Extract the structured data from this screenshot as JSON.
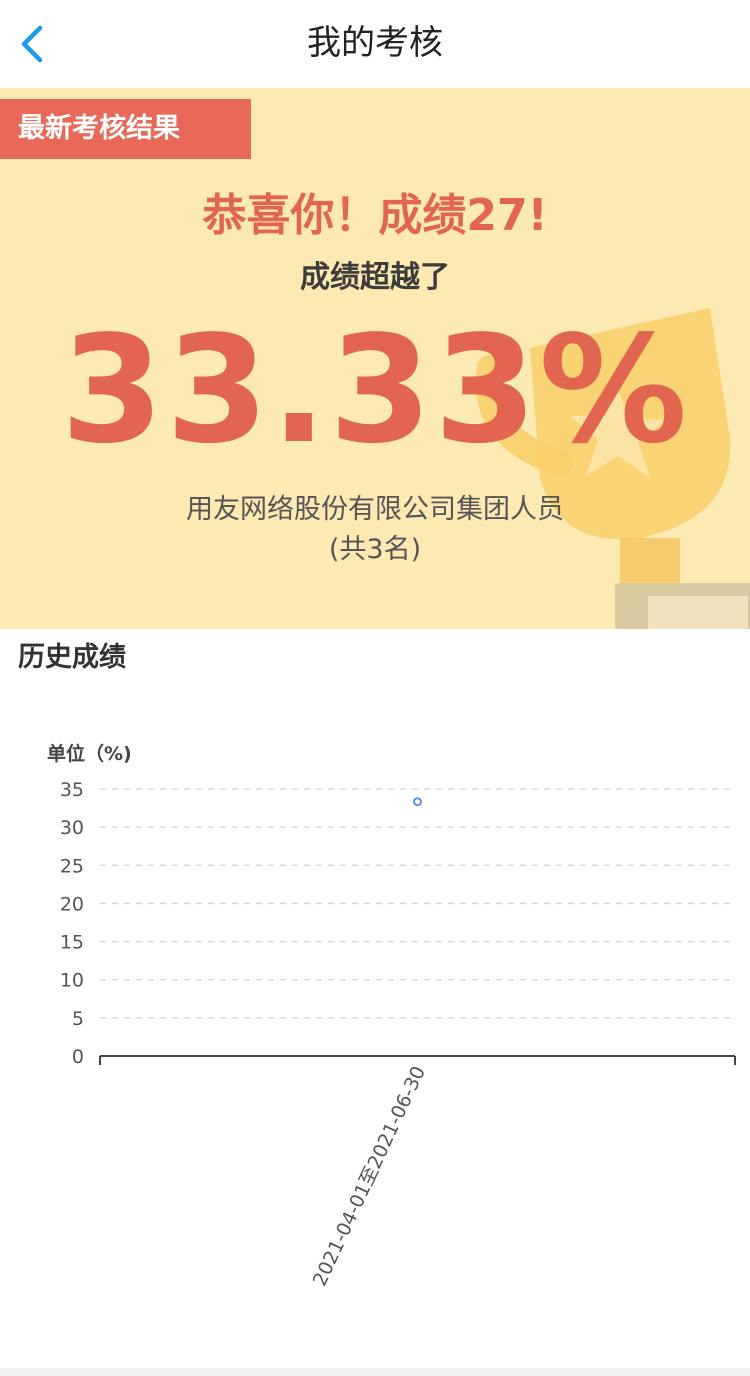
{
  "header": {
    "title": "我的考核",
    "back_icon": "chevron-left-icon",
    "accent_color": "#1e9bf0"
  },
  "result": {
    "tag": "最新考核结果",
    "congrats": "恭喜你！成绩27!",
    "beyond_label": "成绩超越了",
    "percent": "33.33%",
    "org_name": "用友网络股份有限公司集团人员",
    "member_count": "(共3名)",
    "background_color": "#fde9b2",
    "accent_color": "#e2654f",
    "decoration_icon": "trophy-icon"
  },
  "history": {
    "title": "历史成绩"
  },
  "chart_data": {
    "type": "scatter",
    "ylabel": "单位（%)",
    "ylim": [
      0,
      35
    ],
    "yticks": [
      "0",
      "5",
      "10",
      "15",
      "20",
      "25",
      "30",
      "35"
    ],
    "categories": [
      "2021-04-01至2021-06-30"
    ],
    "series": [
      {
        "values": [
          33.33
        ]
      }
    ],
    "grid": true,
    "point_color": "#5b8ff9"
  }
}
